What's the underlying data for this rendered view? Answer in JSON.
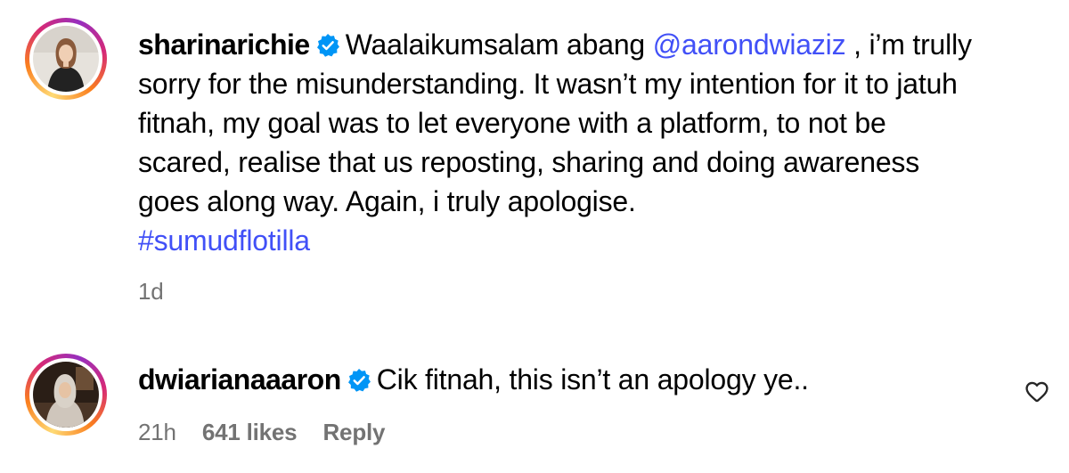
{
  "comments": [
    {
      "username": "sharinarichie",
      "verified": true,
      "text_before_mention": "Waalaikumsalam abang ",
      "mention": "@aarondwiaziz",
      "text_after_mention": " , i’m trully sorry for the misunderstanding. It wasn’t my intention for it to jatuh fitnah, my goal was to let everyone with a platform, to not be scared, realise that us reposting, sharing and doing awareness goes along way. Again, i truly apologise.",
      "hashtag": "#sumudflotilla",
      "time": "1d"
    },
    {
      "username": "dwiarianaaaron",
      "verified": true,
      "text": "Cik fitnah, this isn’t an apology ye..",
      "time": "21h",
      "likes": "641 likes",
      "reply_label": "Reply",
      "like_icon": "heart-outline-icon"
    }
  ],
  "colors": {
    "link": "#4150f7",
    "meta": "#737373",
    "verified": "#0095f6"
  }
}
